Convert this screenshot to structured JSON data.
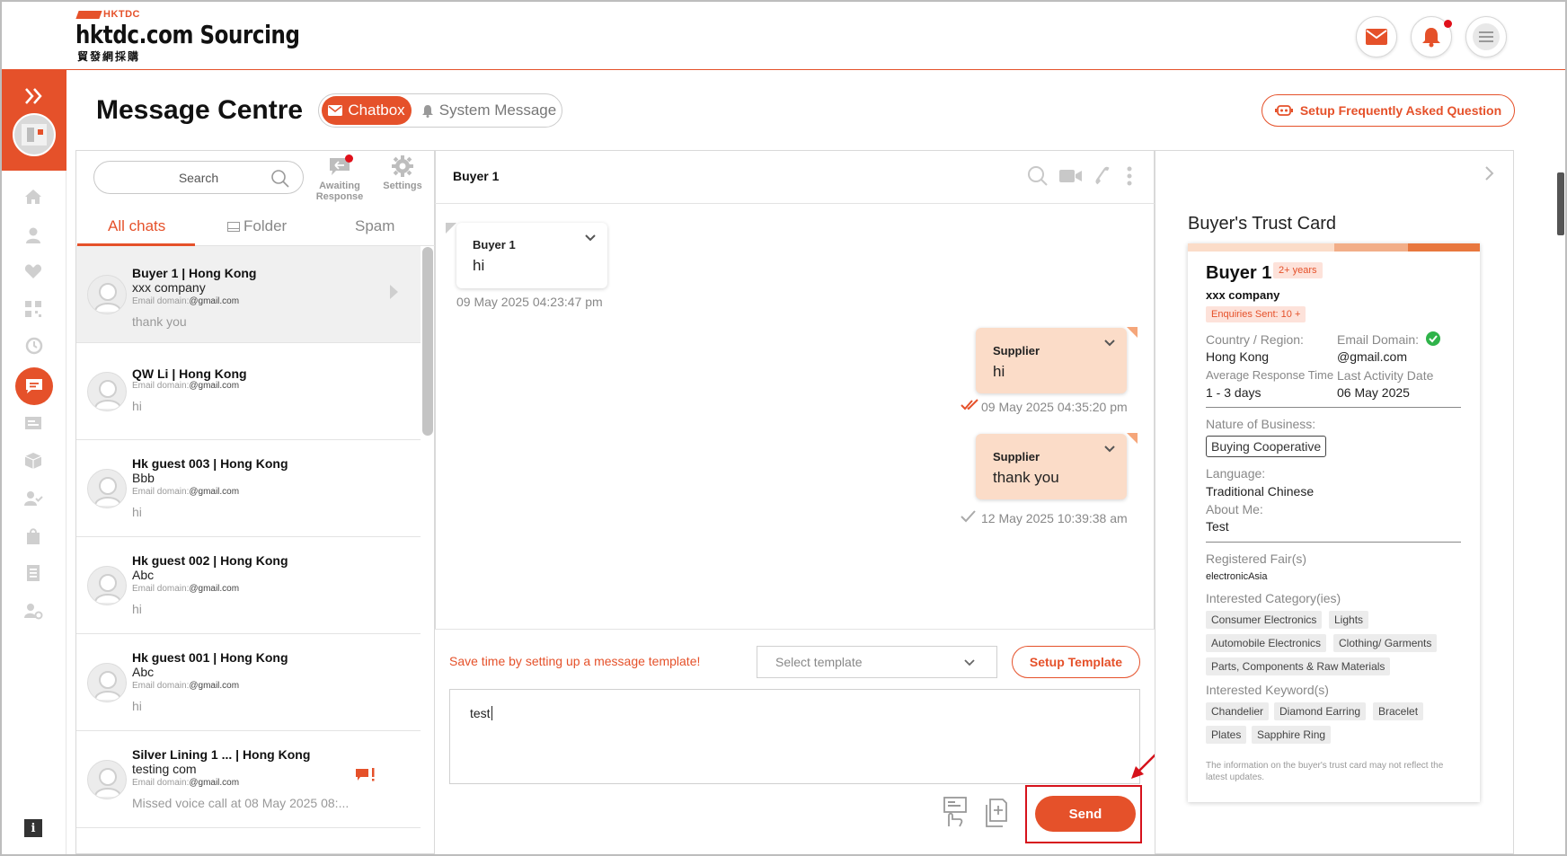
{
  "header": {
    "brand_small": "HKTDC",
    "brand_main": "hktdc.com Sourcing",
    "brand_sub": "貿發網採購"
  },
  "page": {
    "title": "Message Centre",
    "tab_chatbox": "Chatbox",
    "tab_system": "System Message",
    "faq_button": "Setup Frequently Asked Question"
  },
  "list": {
    "search_placeholder": "Search",
    "awaiting_label": "Awaiting Response",
    "settings_label": "Settings",
    "tabs": {
      "all": "All chats",
      "folder": "Folder",
      "spam": "Spam"
    },
    "email_label": "Email domain:",
    "rows": [
      {
        "name": "Buyer 1  |  Hong Kong",
        "company": "xxx company",
        "domain": "@gmail.com",
        "last": "thank you"
      },
      {
        "name": "QW Li  |  Hong Kong",
        "company": "",
        "domain": "@gmail.com",
        "last": "hi"
      },
      {
        "name": "Hk guest 003  |  Hong Kong",
        "company": "Bbb",
        "domain": "@gmail.com",
        "last": "hi"
      },
      {
        "name": "Hk guest 002  |  Hong Kong",
        "company": "Abc",
        "domain": "@gmail.com",
        "last": "hi"
      },
      {
        "name": "Hk guest 001  |  Hong Kong",
        "company": "Abc",
        "domain": "@gmail.com",
        "last": "hi"
      },
      {
        "name": "Silver Lining 1 ...  |  Hong Kong",
        "company": "testing com",
        "domain": "@gmail.com",
        "last": "Missed voice call at 08 May 2025 08:..."
      }
    ]
  },
  "chat": {
    "contact": "Buyer 1",
    "messages": [
      {
        "sender": "Buyer 1",
        "text": "hi",
        "time": "09 May 2025 04:23:47 pm"
      },
      {
        "sender": "Supplier",
        "text": "hi",
        "time": "09 May 2025 04:35:20 pm"
      },
      {
        "sender": "Supplier",
        "text": "thank you",
        "time": "12 May 2025 10:39:38 am"
      }
    ],
    "template_hint": "Save time by setting up a message template!",
    "template_placeholder": "Select template",
    "template_button": "Setup Template",
    "draft": "test",
    "send_label": "Send"
  },
  "trust_card": {
    "title": "Buyer's Trust Card",
    "name": "Buyer 1",
    "years": "2+ years",
    "company": "xxx company",
    "enquiries": "Enquiries Sent: 10 +",
    "country_label": "Country / Region:",
    "country": "Hong Kong",
    "email_label": "Email Domain:",
    "email": "@gmail.com",
    "response_label": "Average Response Time",
    "response": "1 - 3 days",
    "activity_label": "Last Activity Date",
    "activity": "06 May 2025",
    "nature_label": "Nature of Business:",
    "nature": "Buying Cooperative",
    "language_label": "Language:",
    "language": "Traditional Chinese",
    "about_label": "About Me:",
    "about": "Test",
    "fairs_label": "Registered Fair(s)",
    "fairs": "electronicAsia",
    "categories_label": "Interested Category(ies)",
    "categories": [
      "Consumer Electronics",
      "Lights",
      "Automobile Electronics",
      "Clothing/ Garments",
      "Parts, Components & Raw Materials"
    ],
    "keywords_label": "Interested Keyword(s)",
    "keywords": [
      "Chandelier",
      "Diamond Earring",
      "Bracelet",
      "Plates",
      "Sapphire Ring"
    ],
    "note": "The information on the buyer's trust card may not reflect the latest updates."
  },
  "colors": {
    "accent": "#e5512a",
    "supplier_bubble": "#fbdcc8",
    "highlight": "#d6121b"
  }
}
